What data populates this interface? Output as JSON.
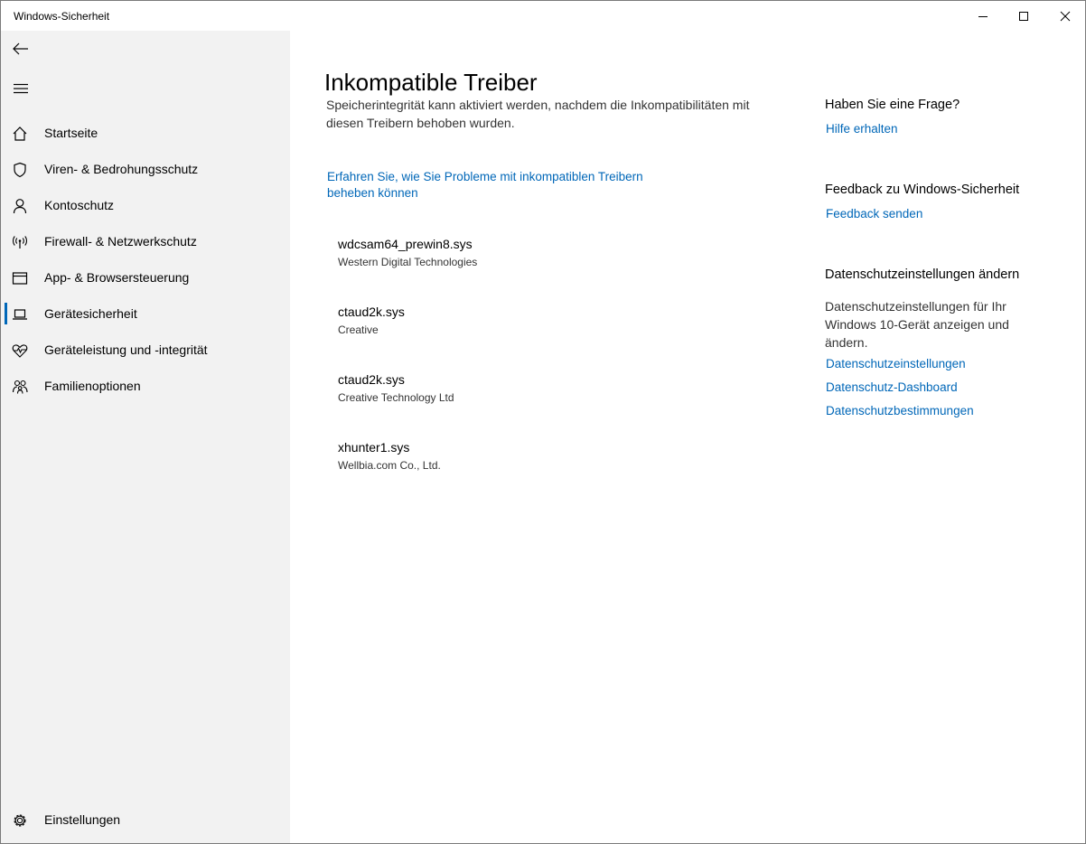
{
  "window": {
    "title": "Windows-Sicherheit"
  },
  "sidebar": {
    "items": [
      {
        "label": "Startseite",
        "icon": "home-icon"
      },
      {
        "label": "Viren- & Bedrohungsschutz",
        "icon": "shield-icon"
      },
      {
        "label": "Kontoschutz",
        "icon": "person-icon"
      },
      {
        "label": "Firewall- & Netzwerkschutz",
        "icon": "wireless-icon"
      },
      {
        "label": "App- & Browsersteuerung",
        "icon": "browser-window-icon"
      },
      {
        "label": "Gerätesicherheit",
        "icon": "laptop-icon",
        "selected": true
      },
      {
        "label": "Geräteleistung und -integrität",
        "icon": "heart-pulse-icon"
      },
      {
        "label": "Familienoptionen",
        "icon": "family-icon"
      }
    ],
    "settings_label": "Einstellungen"
  },
  "main": {
    "title": "Inkompatible Treiber",
    "description": "Speicherintegrität kann aktiviert werden, nachdem die Inkompatibilitäten mit diesen Treibern behoben wurden.",
    "learn_link": "Erfahren Sie, wie Sie Probleme mit inkompatiblen Treibern beheben können",
    "drivers": [
      {
        "name": "wdcsam64_prewin8.sys",
        "vendor": "Western Digital Technologies"
      },
      {
        "name": "ctaud2k.sys",
        "vendor": "Creative"
      },
      {
        "name": "ctaud2k.sys",
        "vendor": "Creative Technology Ltd"
      },
      {
        "name": "xhunter1.sys",
        "vendor": "Wellbia.com Co., Ltd."
      }
    ]
  },
  "right_panel": {
    "question_heading": "Haben Sie eine Frage?",
    "help_link": "Hilfe erhalten",
    "feedback_heading": "Feedback zu Windows-Sicherheit",
    "feedback_link": "Feedback senden",
    "privacy_heading": "Datenschutzeinstellungen ändern",
    "privacy_text": "Datenschutzeinstellungen für Ihr Windows 10-Gerät anzeigen und ändern.",
    "privacy_links": [
      "Datenschutzeinstellungen",
      "Datenschutz-Dashboard",
      "Datenschutzbestimmungen"
    ]
  },
  "colors": {
    "accent": "#0067b8",
    "sidebar_bg": "#f2f2f2"
  }
}
